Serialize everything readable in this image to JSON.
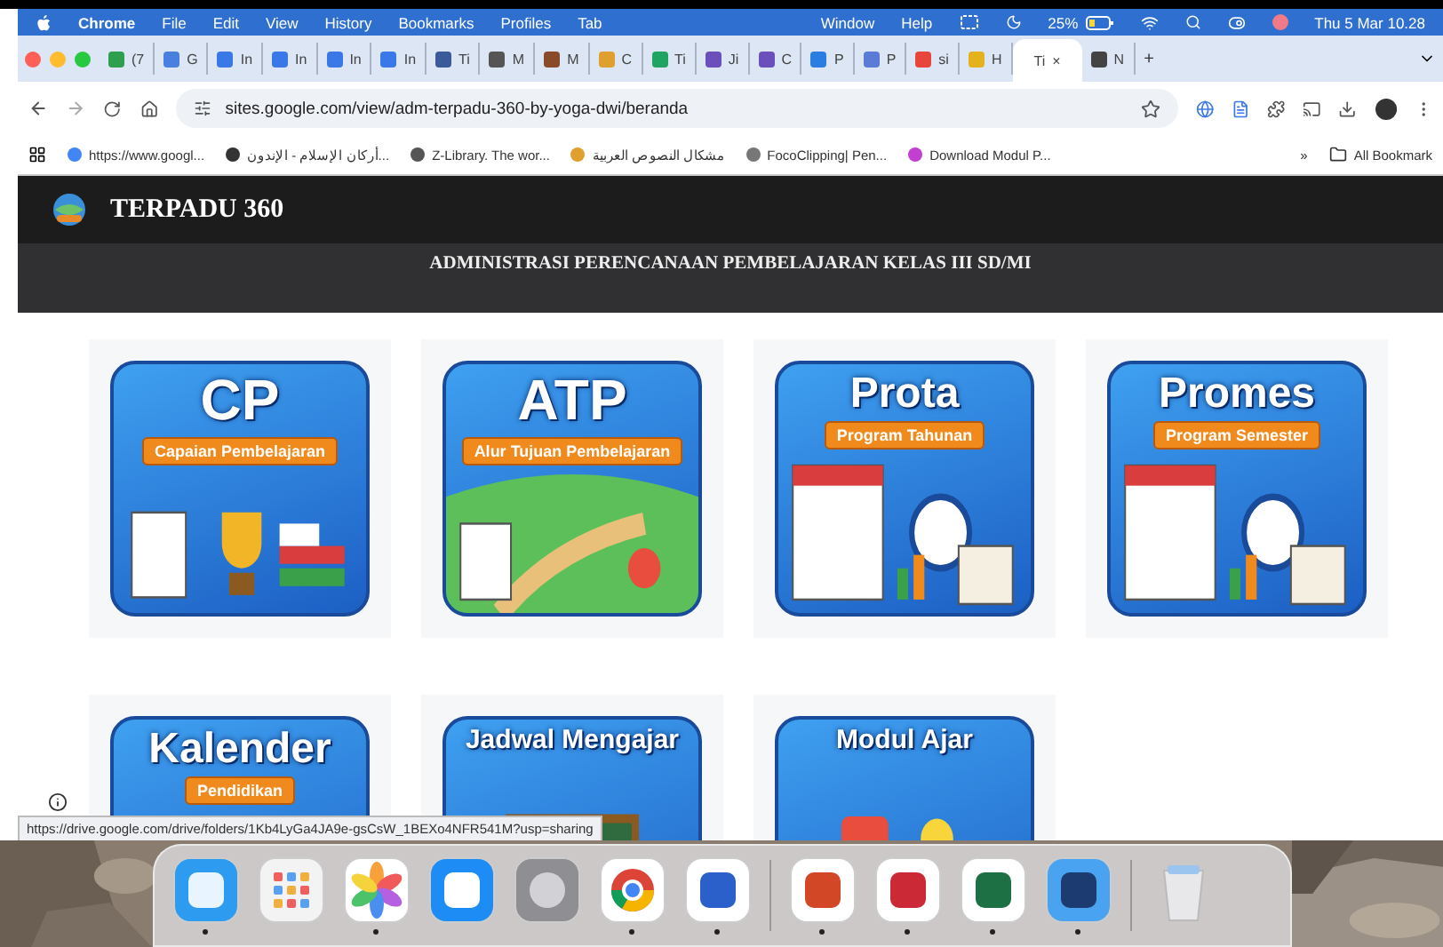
{
  "menu_bar": {
    "items": [
      "Chrome",
      "File",
      "Edit",
      "View",
      "History",
      "Bookmarks",
      "Profiles",
      "Tab"
    ],
    "right_items": [
      "Window",
      "Help"
    ],
    "battery": "25%",
    "clock": "Thu 5 Mar 10.28"
  },
  "tabs": [
    {
      "label": "(7",
      "color": "#2e9e4f",
      "selected": false
    },
    {
      "label": "G",
      "color": "#4a7fe0",
      "selected": false
    },
    {
      "label": "In",
      "color": "#3b78e7",
      "selected": false
    },
    {
      "label": "In",
      "color": "#3b78e7",
      "selected": false
    },
    {
      "label": "In",
      "color": "#3b78e7",
      "selected": false
    },
    {
      "label": "In",
      "color": "#3b78e7",
      "selected": false
    },
    {
      "label": "Ti",
      "color": "#3c5a9a",
      "selected": false
    },
    {
      "label": "M",
      "color": "#555555",
      "selected": false
    },
    {
      "label": "M",
      "color": "#8a4b2a",
      "selected": false
    },
    {
      "label": "C",
      "color": "#e0a030",
      "selected": false
    },
    {
      "label": "Ti",
      "color": "#1fa463",
      "selected": false
    },
    {
      "label": "Ji",
      "color": "#6b4fbb",
      "selected": false
    },
    {
      "label": "C",
      "color": "#6b4fbb",
      "selected": false
    },
    {
      "label": "P",
      "color": "#2a7de1",
      "selected": false
    },
    {
      "label": "P",
      "color": "#5b7bd6",
      "selected": false
    },
    {
      "label": "si",
      "color": "#e8453c",
      "selected": false
    },
    {
      "label": "H",
      "color": "#e3b21d",
      "selected": false
    },
    {
      "label": "Ti",
      "close": "×",
      "selected": true
    },
    {
      "label": "N",
      "color": "#444444",
      "selected": false
    }
  ],
  "new_tab": "+",
  "address": "sites.google.com/view/adm-terpadu-360-by-yoga-dwi/beranda",
  "bookmarks": [
    {
      "label": "https://www.googl...",
      "color": "#4285f4"
    },
    {
      "label": "أركان الإسلام - الإندون...",
      "color": "#333333"
    },
    {
      "label": "Z-Library. The wor...",
      "color": "#555555"
    },
    {
      "label": "مشكال النصوص العربية",
      "color": "#e0a030"
    },
    {
      "label": "FocoClipping| Pen...",
      "color": "#777777"
    },
    {
      "label": "Download Modul P...",
      "color": "#c23fd1"
    }
  ],
  "more_bookmarks": "»",
  "all_bookmarks": "All Bookmark",
  "site": {
    "title": "TERPADU 360",
    "subtitle": "ADMINISTRASI PERENCANAAN PEMBELAJARAN KELAS III SD/MI"
  },
  "tiles": [
    {
      "title": "CP",
      "ribbon": "Capaian Pembelajaran",
      "kind": "cp"
    },
    {
      "title": "ATP",
      "ribbon": "Alur Tujuan Pembelajaran",
      "kind": "atp"
    },
    {
      "title": "Prota",
      "ribbon": "Program Tahunan",
      "kind": "calendar"
    },
    {
      "title": "Promes",
      "ribbon": "Program Semester",
      "kind": "calendar"
    },
    {
      "title": "Kalender",
      "ribbon": "Pendidikan",
      "kind": "calendar"
    },
    {
      "title": "Jadwal Mengajar",
      "kind": "board"
    },
    {
      "title": "Modul Ajar",
      "kind": "book"
    }
  ],
  "status_url": "https://drive.google.com/drive/folders/1Kb4LyGa4JA9e-gsCsW_1BEXo4NFR541M?usp=sharing",
  "dock": [
    {
      "kind": "finder",
      "running": true
    },
    {
      "kind": "launchpad",
      "running": false
    },
    {
      "kind": "photos",
      "running": true
    },
    {
      "kind": "appstore",
      "running": false
    },
    {
      "kind": "settings",
      "running": false
    },
    {
      "kind": "chrome",
      "running": true
    },
    {
      "kind": "word",
      "running": true
    },
    {
      "kind": "powerpoint",
      "running": true
    },
    {
      "kind": "zotero",
      "running": true
    },
    {
      "kind": "excel",
      "running": true
    },
    {
      "kind": "preview",
      "running": true
    },
    {
      "kind": "trash",
      "running": false
    }
  ]
}
